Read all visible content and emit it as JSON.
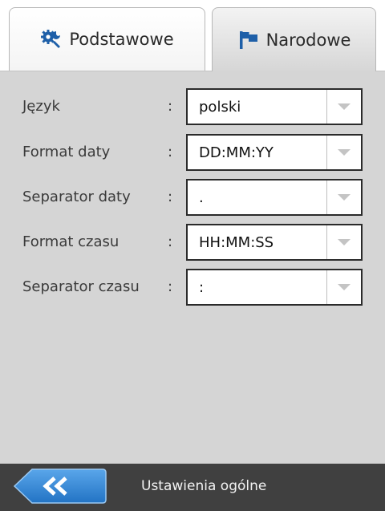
{
  "tabs": {
    "basic": {
      "label": "Podstawowe",
      "icon": "gears-icon"
    },
    "national": {
      "label": "Narodowe",
      "icon": "flag-icon",
      "active": true
    }
  },
  "settings": [
    {
      "label": "Język",
      "colon": ":",
      "value": "polski"
    },
    {
      "label": "Format daty",
      "colon": ":",
      "value": "DD:MM:YY"
    },
    {
      "label": "Separator daty",
      "colon": ":",
      "value": "."
    },
    {
      "label": "Format czasu",
      "colon": ":",
      "value": "HH:MM:SS"
    },
    {
      "label": "Separator czasu",
      "colon": ":",
      "value": ":"
    }
  ],
  "footer": {
    "title": "Ustawienia ogólne",
    "back_icon": "double-chevron-left-icon"
  },
  "colors": {
    "panel_bg": "#d5d5d5",
    "footer_bg": "#404040",
    "back_button": "#2f82d1",
    "icon_blue": "#1e5fa8"
  }
}
